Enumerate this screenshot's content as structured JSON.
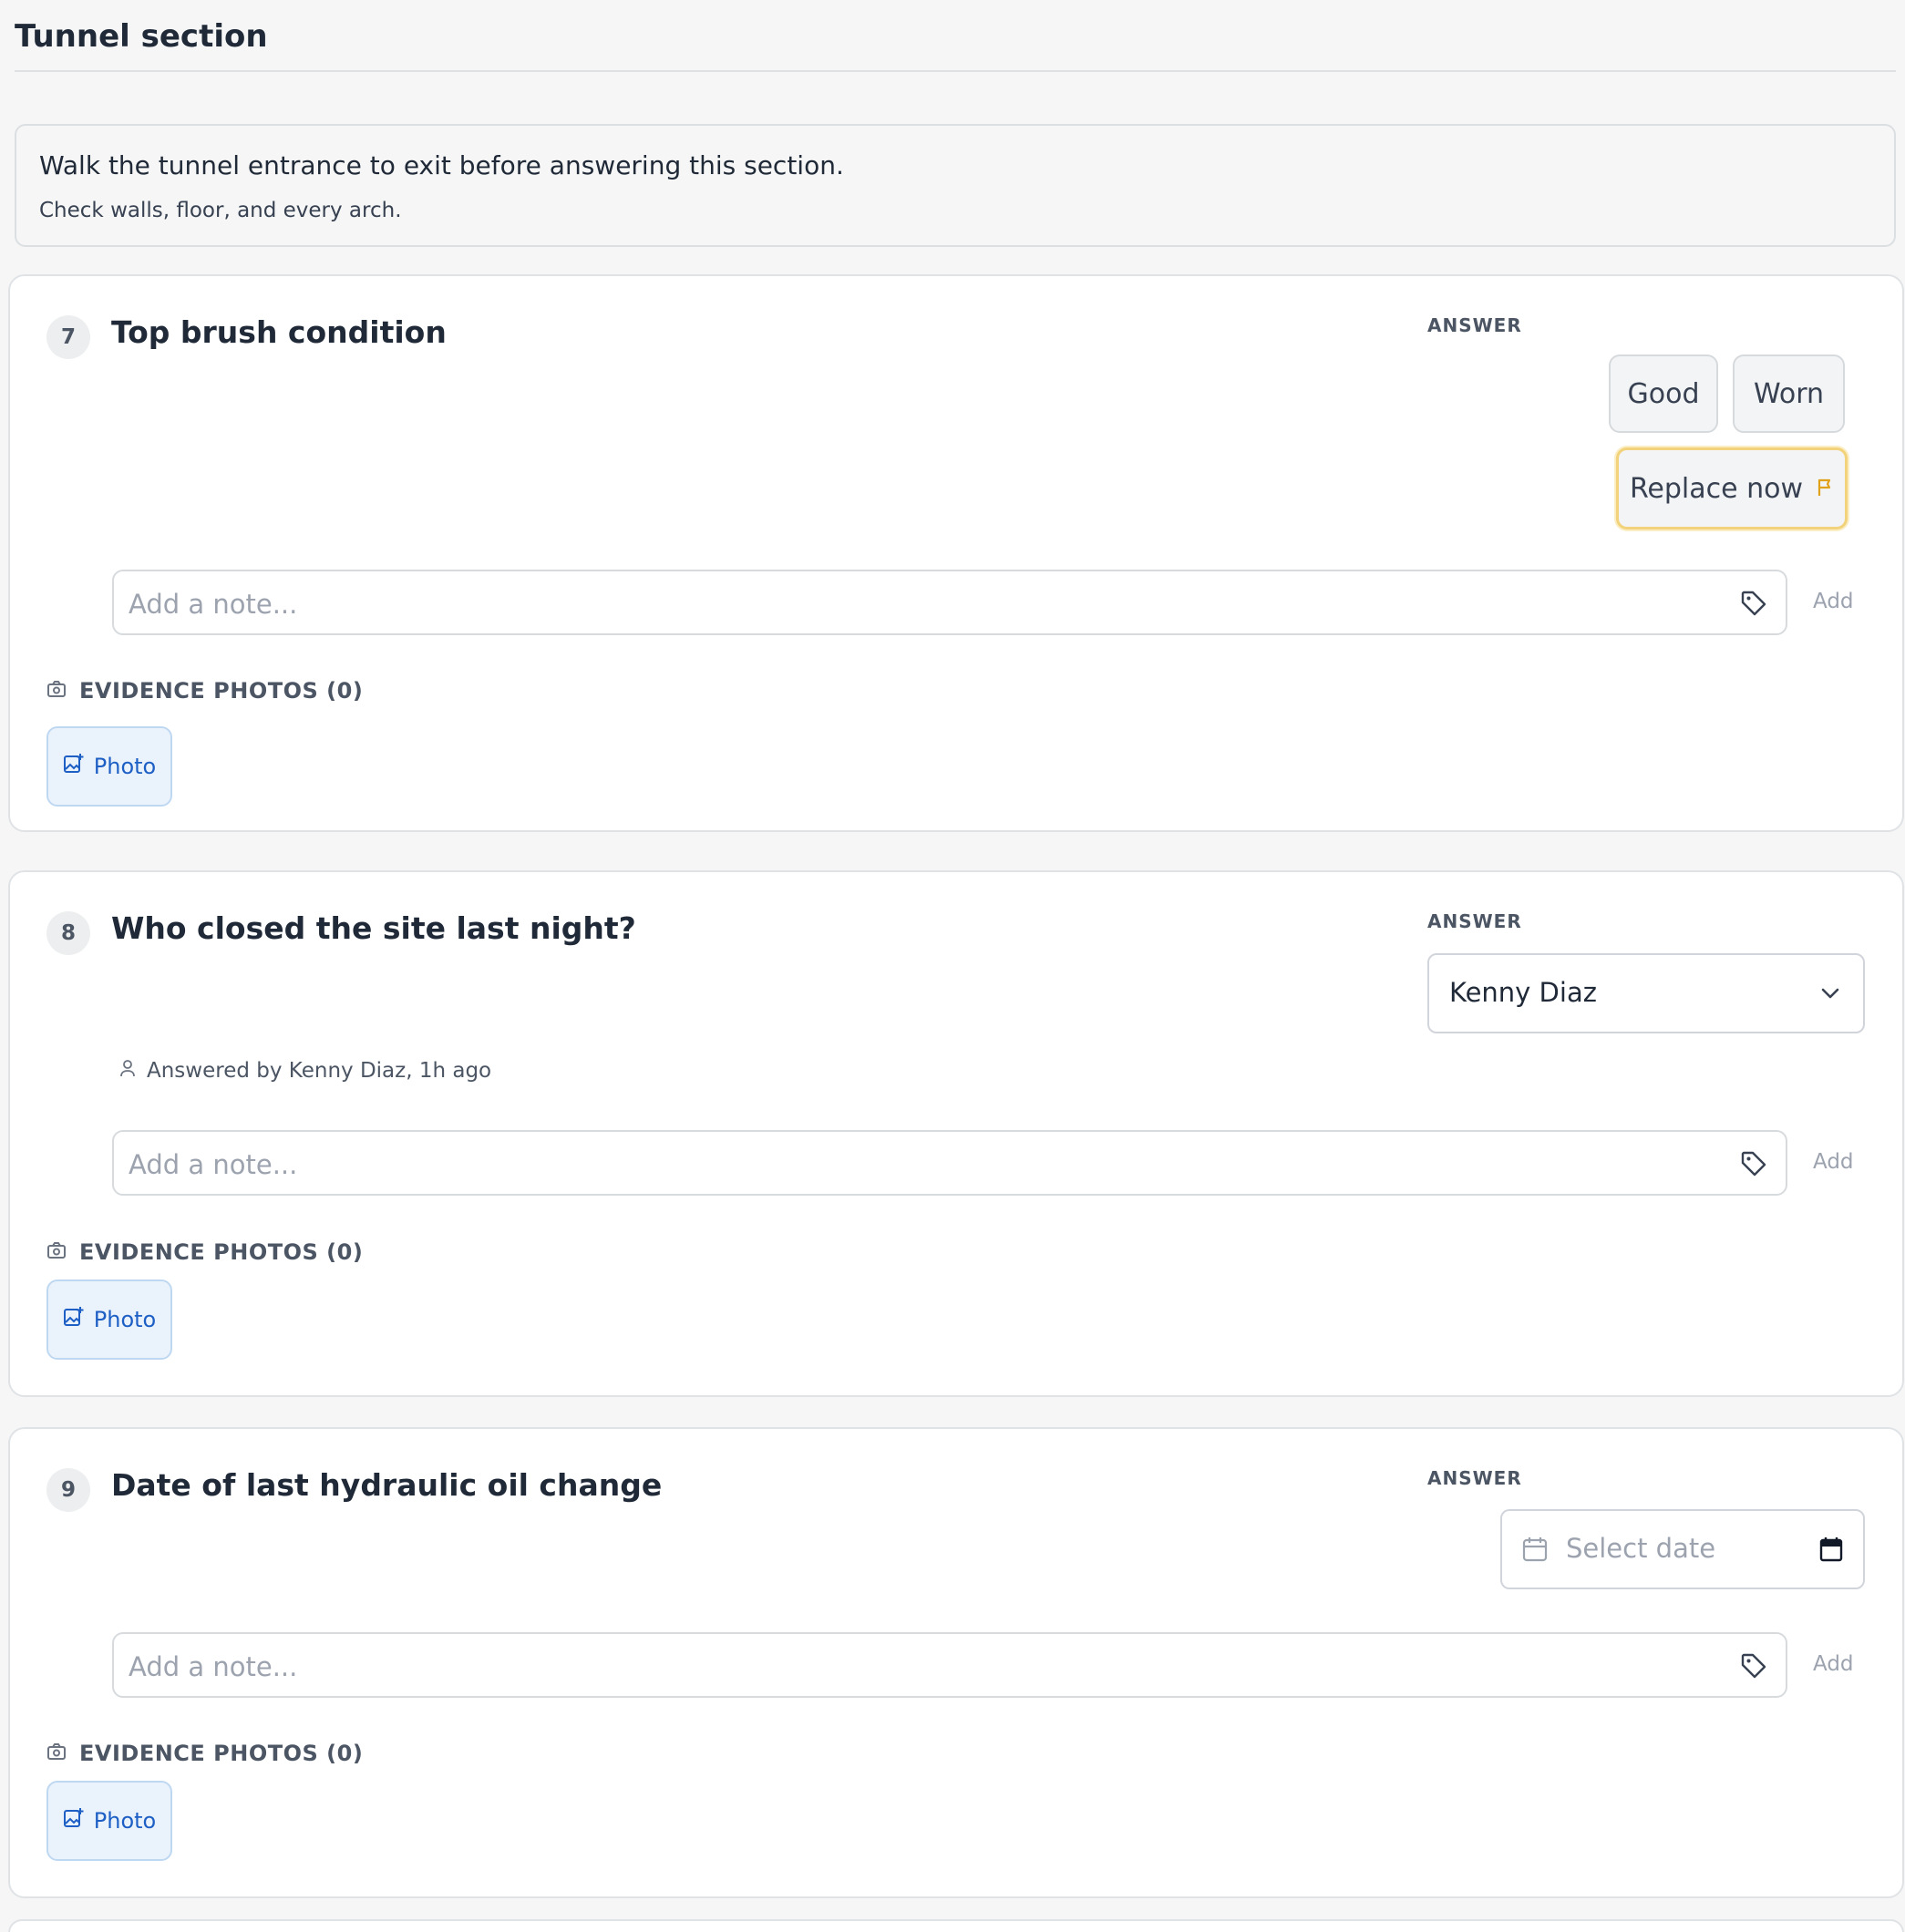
{
  "section": {
    "title": "Tunnel section",
    "intro_main": "Walk the tunnel entrance to exit before answering this section.",
    "intro_sub": "Check walls, floor, and every arch."
  },
  "common": {
    "answer_label": "ANSWER",
    "note_placeholder": "Add a note...",
    "add_label": "Add",
    "evidence_label": "EVIDENCE PHOTOS (0)",
    "photo_label": "Photo"
  },
  "questions": [
    {
      "number": "7",
      "title": "Top brush condition",
      "options": [
        "Good",
        "Worn",
        "Replace now"
      ],
      "flagged_option": "Replace now"
    },
    {
      "number": "8",
      "title": "Who closed the site last night?",
      "selected": "Kenny Diaz",
      "answered_by": "Answered by Kenny Diaz, 1h ago"
    },
    {
      "number": "9",
      "title": "Date of last hydraulic oil change",
      "date_placeholder": "Select date"
    }
  ],
  "colors": {
    "flag": "#e0a21a",
    "photo_accent": "#1d5fc4"
  },
  "icons": [
    "flag-icon",
    "tag-icon",
    "camera-icon",
    "image-plus-icon",
    "chevron-down-icon",
    "user-icon",
    "calendar-icon"
  ]
}
